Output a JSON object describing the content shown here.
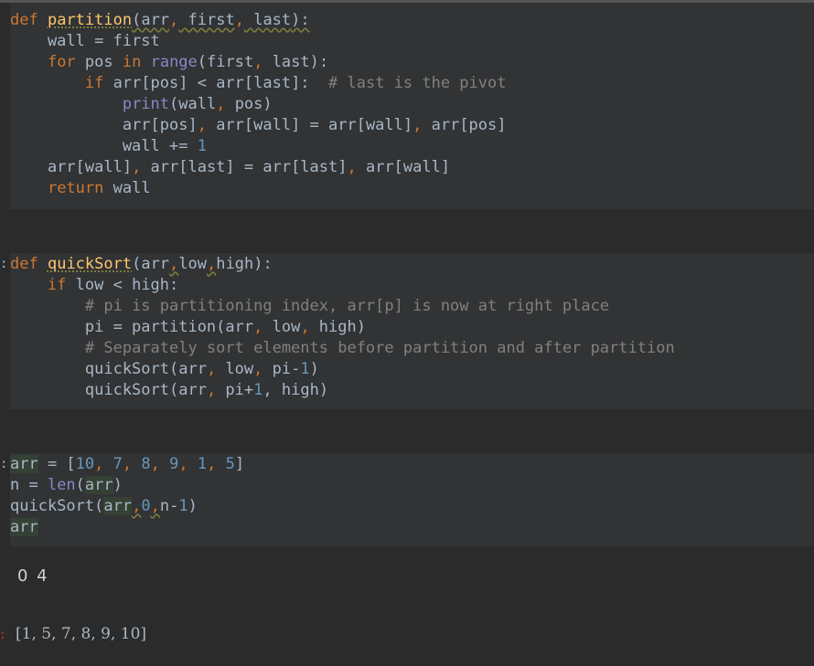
{
  "cells": [
    {
      "lines": [
        [
          {
            "t": "def",
            "c": "kw"
          },
          {
            "t": " "
          },
          {
            "t": "partition",
            "c": "fn"
          },
          {
            "t": "(arr",
            "c": "warn"
          },
          {
            "t": ",",
            "c": "comma"
          },
          {
            "t": " first",
            "c": "warn"
          },
          {
            "t": ",",
            "c": "comma"
          },
          {
            "t": " last",
            "c": "warn"
          },
          {
            "t": "):",
            "c": "warn"
          }
        ],
        [
          {
            "t": "    wall = first"
          }
        ],
        [
          {
            "t": "    "
          },
          {
            "t": "for",
            "c": "kw"
          },
          {
            "t": " pos "
          },
          {
            "t": "in",
            "c": "kw"
          },
          {
            "t": " "
          },
          {
            "t": "range",
            "c": "bi"
          },
          {
            "t": "(first"
          },
          {
            "t": ",",
            "c": "comma"
          },
          {
            "t": " last):"
          }
        ],
        [
          {
            "t": "        "
          },
          {
            "t": "if",
            "c": "kw"
          },
          {
            "t": " arr[pos] < arr[last]:  "
          },
          {
            "t": "# last is the pivot",
            "c": "cm"
          }
        ],
        [
          {
            "t": "            "
          },
          {
            "t": "print",
            "c": "bi"
          },
          {
            "t": "(wall"
          },
          {
            "t": ",",
            "c": "comma"
          },
          {
            "t": " pos)"
          }
        ],
        [
          {
            "t": "            arr[pos]"
          },
          {
            "t": ",",
            "c": "comma"
          },
          {
            "t": " arr[wall] = arr[wall]"
          },
          {
            "t": ",",
            "c": "comma"
          },
          {
            "t": " arr[pos]"
          }
        ],
        [
          {
            "t": "            wall += "
          },
          {
            "t": "1",
            "c": "num"
          }
        ],
        [
          {
            "t": "    arr[wall]"
          },
          {
            "t": ",",
            "c": "comma"
          },
          {
            "t": " arr[last] = arr[last]"
          },
          {
            "t": ",",
            "c": "comma"
          },
          {
            "t": " arr[wall]"
          }
        ],
        [
          {
            "t": "    "
          },
          {
            "t": "return",
            "c": "kw"
          },
          {
            "t": " wall"
          }
        ]
      ]
    },
    {
      "prompt": ":",
      "lines": [
        [
          {
            "t": "def",
            "c": "kw"
          },
          {
            "t": " "
          },
          {
            "t": "quickSort",
            "c": "fn"
          },
          {
            "t": "(arr"
          },
          {
            "t": ",",
            "c": "comma warn"
          },
          {
            "t": "low"
          },
          {
            "t": ",",
            "c": "comma warn"
          },
          {
            "t": "high):"
          }
        ],
        [
          {
            "t": "    "
          },
          {
            "t": "if",
            "c": "kw"
          },
          {
            "t": " low < high:"
          }
        ],
        [
          {
            "t": "        "
          },
          {
            "t": "# pi is partitioning index, arr[p] is now at right place",
            "c": "cm"
          }
        ],
        [
          {
            "t": "        pi = partition(arr"
          },
          {
            "t": ",",
            "c": "comma"
          },
          {
            "t": " low"
          },
          {
            "t": ",",
            "c": "comma"
          },
          {
            "t": " high)"
          }
        ],
        [
          {
            "t": "        "
          },
          {
            "t": "# Separately sort elements before partition and after partition",
            "c": "cm"
          }
        ],
        [
          {
            "t": "        quickSort(arr"
          },
          {
            "t": ",",
            "c": "comma"
          },
          {
            "t": " low"
          },
          {
            "t": ",",
            "c": "comma"
          },
          {
            "t": " pi-"
          },
          {
            "t": "1",
            "c": "num"
          },
          {
            "t": ")"
          }
        ],
        [
          {
            "t": "        quickSort(arr"
          },
          {
            "t": ",",
            "c": "comma"
          },
          {
            "t": " pi+"
          },
          {
            "t": "1",
            "c": "num"
          },
          {
            "t": ","
          },
          {
            "t": " high)"
          }
        ]
      ]
    },
    {
      "prompt": ":",
      "lines": [
        [
          {
            "t": "arr",
            "c": "hl"
          },
          {
            "t": " = ["
          },
          {
            "t": "10",
            "c": "num"
          },
          {
            "t": ",",
            "c": "comma"
          },
          {
            "t": " "
          },
          {
            "t": "7",
            "c": "num"
          },
          {
            "t": ",",
            "c": "comma"
          },
          {
            "t": " "
          },
          {
            "t": "8",
            "c": "num"
          },
          {
            "t": ",",
            "c": "comma"
          },
          {
            "t": " "
          },
          {
            "t": "9",
            "c": "num"
          },
          {
            "t": ",",
            "c": "comma"
          },
          {
            "t": " "
          },
          {
            "t": "1",
            "c": "num"
          },
          {
            "t": ",",
            "c": "comma"
          },
          {
            "t": " "
          },
          {
            "t": "5",
            "c": "num"
          },
          {
            "t": "]"
          }
        ],
        [
          {
            "t": "n = "
          },
          {
            "t": "len",
            "c": "bi"
          },
          {
            "t": "("
          },
          {
            "t": "arr",
            "c": "hl"
          },
          {
            "t": ")"
          }
        ],
        [
          {
            "t": "quickSort("
          },
          {
            "t": "arr",
            "c": "hl"
          },
          {
            "t": ",",
            "c": "comma warn"
          },
          {
            "t": "0",
            "c": "num"
          },
          {
            "t": ",",
            "c": "comma warn"
          },
          {
            "t": "n-"
          },
          {
            "t": "1",
            "c": "num"
          },
          {
            "t": ")"
          }
        ],
        [
          {
            "t": "arr",
            "c": "hl"
          }
        ]
      ]
    }
  ],
  "output_print": "0 4",
  "output_result_prompt": ":",
  "output_result": "[1,  5,  7,  8,  9,  10]"
}
